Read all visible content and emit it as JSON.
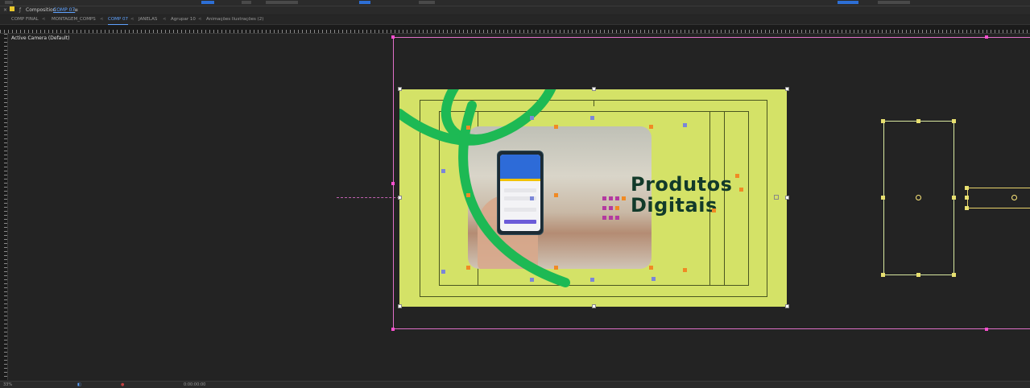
{
  "panel": {
    "close_glyph": "×",
    "title_prefix": "Composition",
    "comp_name": "COMP 07",
    "menu_glyph": "≡"
  },
  "tabs": [
    {
      "label": "COMP FINAL"
    },
    {
      "label": "MONTAGEM_COMPS"
    },
    {
      "label": "COMP 07",
      "active": true
    },
    {
      "label": "JANELAS"
    },
    {
      "label": "Agrupar 10"
    },
    {
      "label": "Animações Ilustrações (2)"
    }
  ],
  "canvas": {
    "label": "Active Camera (Default)"
  },
  "artboard": {
    "headline_line1": "Produtos",
    "headline_line2": "Digitais",
    "colors": {
      "background": "#d4e267",
      "stroke": "#1db954",
      "headline": "#123a2a",
      "frame": "#e070c8"
    }
  },
  "statusbar": {
    "zoom": "33%",
    "timecode": "0:00:00:00"
  },
  "icons": [
    "close-icon",
    "composition-icon",
    "menu-icon",
    "lock-icon",
    "anchor-point-icon"
  ]
}
